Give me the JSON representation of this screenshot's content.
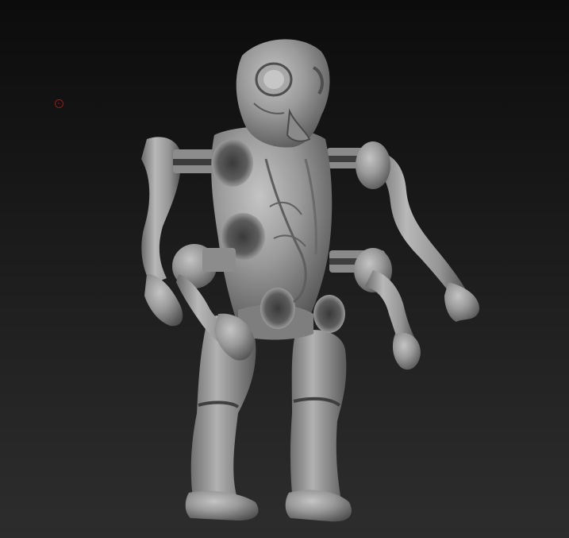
{
  "viewport": {
    "background_top": "#0c0c0c",
    "background_bottom": "#2d2d2d"
  },
  "brush_cursor": {
    "icon": "brush-circle-icon",
    "color": "#9a1a1a"
  },
  "model": {
    "material_color": "#8e8e8e",
    "shadow_color": "#3a3a3a",
    "highlight_color": "#c8c8c8"
  }
}
